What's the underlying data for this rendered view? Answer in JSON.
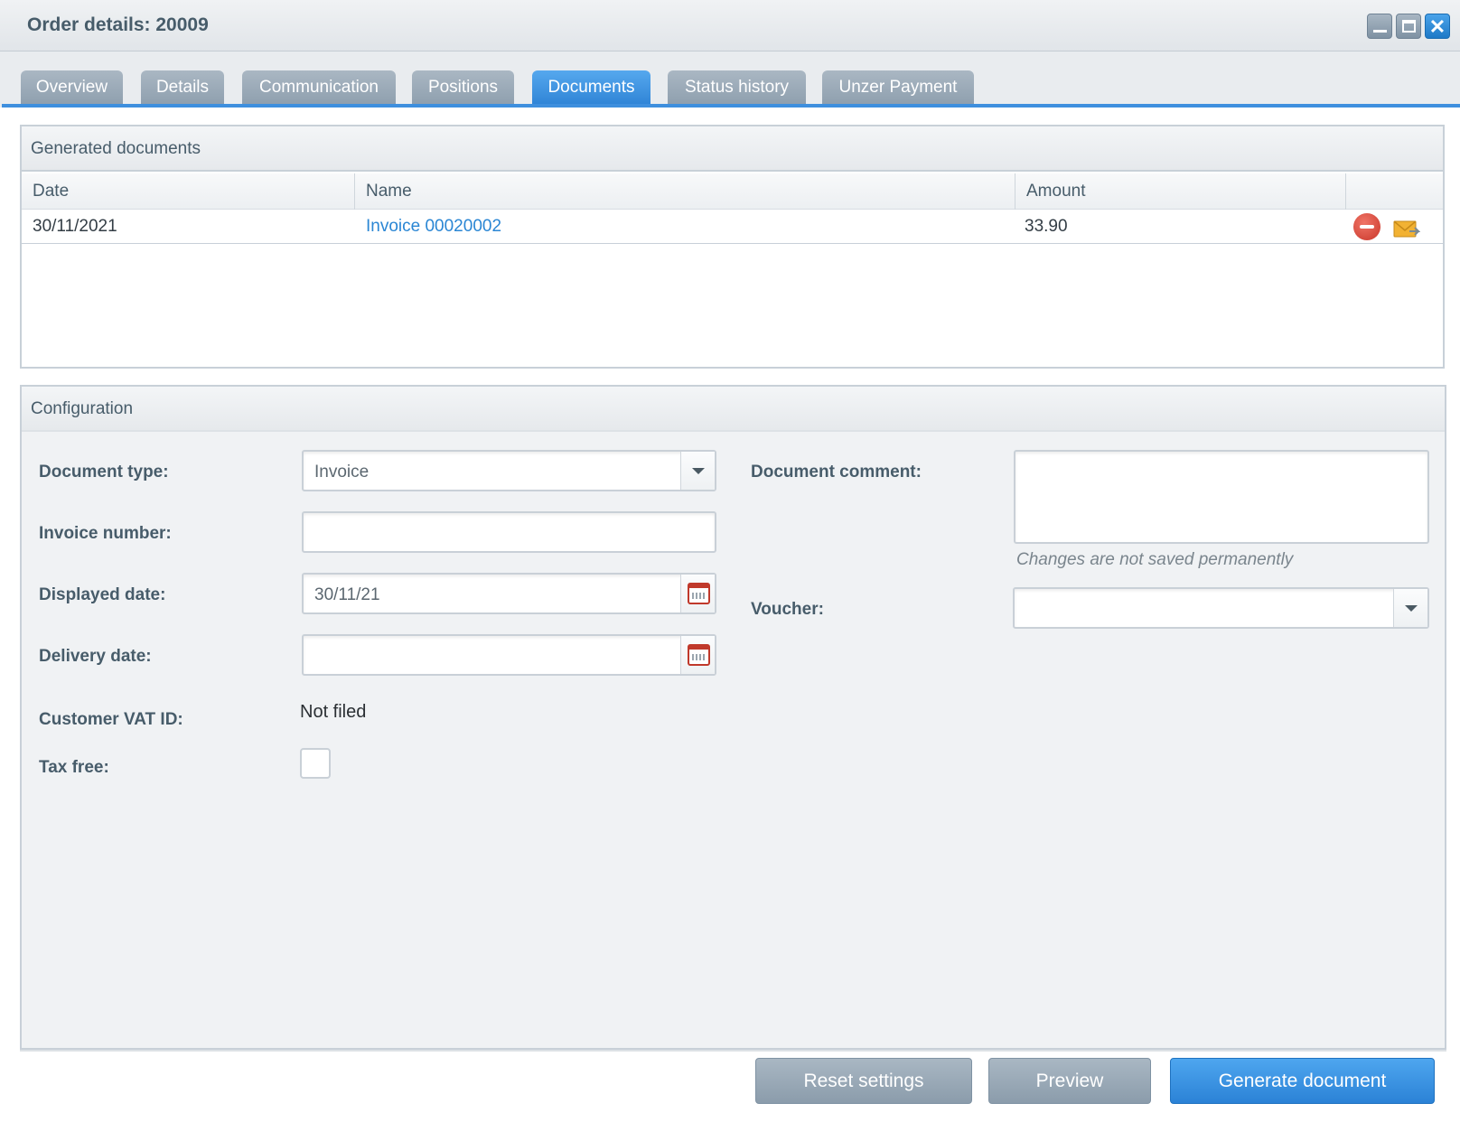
{
  "window": {
    "title": "Order details: 20009",
    "controls": {
      "minimize": "minimize-icon",
      "maximize": "maximize-icon",
      "close": "close-icon"
    }
  },
  "tabs": [
    {
      "label": "Overview",
      "active": false
    },
    {
      "label": "Details",
      "active": false
    },
    {
      "label": "Communication",
      "active": false
    },
    {
      "label": "Positions",
      "active": false
    },
    {
      "label": "Documents",
      "active": true
    },
    {
      "label": "Status history",
      "active": false
    },
    {
      "label": "Unzer Payment",
      "active": false
    }
  ],
  "generated": {
    "title": "Generated documents",
    "columns": [
      "Date",
      "Name",
      "Amount",
      ""
    ],
    "rows": [
      {
        "date": "30/11/2021",
        "name": "Invoice 00020002",
        "amount": "33.90"
      }
    ],
    "row_actions": {
      "delete": "delete-icon",
      "mail": "send-mail-icon"
    }
  },
  "config": {
    "title": "Configuration",
    "document_type": {
      "label": "Document type:",
      "value": "Invoice"
    },
    "invoice_number": {
      "label": "Invoice number:",
      "value": ""
    },
    "displayed_date": {
      "label": "Displayed date:",
      "value": "30/11/21"
    },
    "delivery_date": {
      "label": "Delivery date:",
      "value": ""
    },
    "customer_vat": {
      "label": "Customer VAT ID:",
      "value": "Not filed"
    },
    "tax_free": {
      "label": "Tax free:",
      "checked": false
    },
    "document_comment": {
      "label": "Document comment:",
      "value": "",
      "hint": "Changes are not saved permanently"
    },
    "voucher": {
      "label": "Voucher:",
      "value": ""
    }
  },
  "buttons": {
    "reset": "Reset settings",
    "preview": "Preview",
    "generate": "Generate document"
  },
  "colors": {
    "accent": "#3e8fde",
    "link": "#2a86d4",
    "delete": "#d64436"
  }
}
